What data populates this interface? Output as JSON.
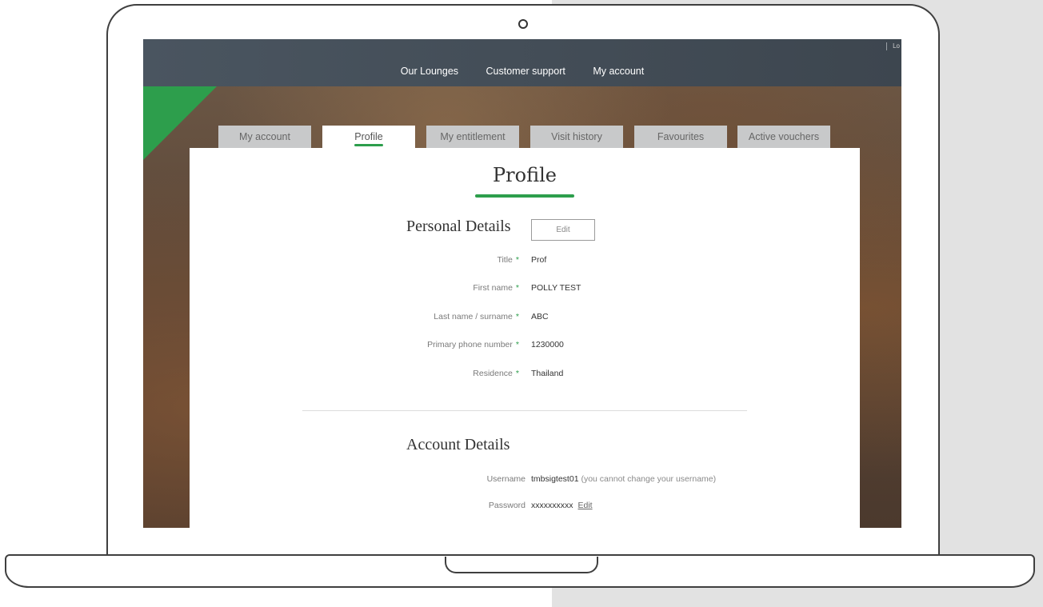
{
  "topbar": {
    "corner_text": "Lo"
  },
  "nav": [
    "Our Lounges",
    "Customer support",
    "My account"
  ],
  "tabs": [
    {
      "label": "My account",
      "active": false
    },
    {
      "label": "Profile",
      "active": true
    },
    {
      "label": "My entitlement",
      "active": false
    },
    {
      "label": "Visit history",
      "active": false
    },
    {
      "label": "Favourites",
      "active": false
    },
    {
      "label": "Active vouchers",
      "active": false
    }
  ],
  "page_title": "Profile",
  "personal": {
    "heading": "Personal Details",
    "edit_label": "Edit",
    "fields": [
      {
        "label": "Title",
        "value": "Prof"
      },
      {
        "label": "First name",
        "value": "POLLY TEST"
      },
      {
        "label": "Last name / surname",
        "value": "ABC"
      },
      {
        "label": "Primary phone number",
        "value": "1230000"
      },
      {
        "label": "Residence",
        "value": "Thailand"
      }
    ],
    "required_mark": "*"
  },
  "account": {
    "heading": "Account Details",
    "username_label": "Username",
    "username_value": "tmbsigtest01",
    "username_note": "(you cannot change your username)",
    "password_label": "Password",
    "password_value": "xxxxxxxxxx",
    "password_edit": "Edit"
  },
  "colors": {
    "accent": "#2d9e4c",
    "topbar": "#3f4851",
    "tab_inactive": "#c8c9ca"
  }
}
